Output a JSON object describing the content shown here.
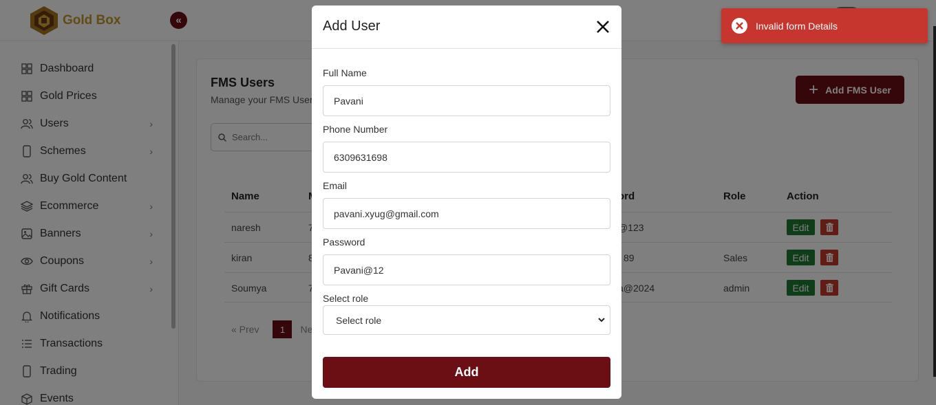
{
  "app": {
    "brand": "Gold Box",
    "collapse_icon": "«"
  },
  "sidebar": {
    "items": [
      {
        "label": "Dashboard",
        "icon": "grid-icon",
        "has_submenu": false
      },
      {
        "label": "Gold Prices",
        "icon": "grid-icon",
        "has_submenu": false
      },
      {
        "label": "Users",
        "icon": "users-icon",
        "has_submenu": true
      },
      {
        "label": "Schemes",
        "icon": "phone-icon",
        "has_submenu": true
      },
      {
        "label": "Buy Gold Content",
        "icon": "users-icon",
        "has_submenu": false
      },
      {
        "label": "Ecommerce",
        "icon": "layers-icon",
        "has_submenu": true
      },
      {
        "label": "Banners",
        "icon": "image-icon",
        "has_submenu": true
      },
      {
        "label": "Coupons",
        "icon": "eye-icon",
        "has_submenu": true
      },
      {
        "label": "Gift Cards",
        "icon": "gift-icon",
        "has_submenu": true
      },
      {
        "label": "Notifications",
        "icon": "bell-icon",
        "has_submenu": false
      },
      {
        "label": "Transactions",
        "icon": "list-icon",
        "has_submenu": false
      },
      {
        "label": "Trading",
        "icon": "phone-icon",
        "has_submenu": false
      },
      {
        "label": "Events",
        "icon": "box-icon",
        "has_submenu": false
      }
    ]
  },
  "page": {
    "title": "FMS Users",
    "subtitle": "Manage your FMS User",
    "add_button": "Add FMS User",
    "search_placeholder": "Search..."
  },
  "table": {
    "headers": {
      "name": "Name",
      "mobile": "M",
      "password": "ord",
      "role": "Role",
      "action": "Action"
    },
    "rows": [
      {
        "name": "naresh",
        "mobile": "7",
        "password": "@123",
        "role": ""
      },
      {
        "name": "kiran",
        "mobile": "8",
        "password": "89",
        "role": "Sales"
      },
      {
        "name": "Soumya",
        "mobile": "7",
        "password": "a@2024",
        "role": "admin"
      }
    ],
    "edit_label": "Edit"
  },
  "pagination": {
    "prev": "« Prev",
    "current": "1",
    "next": "Ne"
  },
  "modal": {
    "title": "Add User",
    "fields": {
      "full_name": {
        "label": "Full Name",
        "value": "Pavani"
      },
      "phone": {
        "label": "Phone Number",
        "value": "6309631698"
      },
      "email": {
        "label": "Email",
        "value": "pavani.xyug@gmail.com"
      },
      "password": {
        "label": "Password",
        "value": "Pavani@12"
      },
      "role": {
        "label": "Select role",
        "selected": "Select role"
      }
    },
    "submit_label": "Add"
  },
  "toast": {
    "message": "Invalid form Details",
    "type": "error"
  },
  "colors": {
    "primary": "#6b0f14",
    "gold": "#c5962c",
    "error": "#c6362e",
    "edit": "#1f7a33",
    "delete": "#c0392b"
  }
}
